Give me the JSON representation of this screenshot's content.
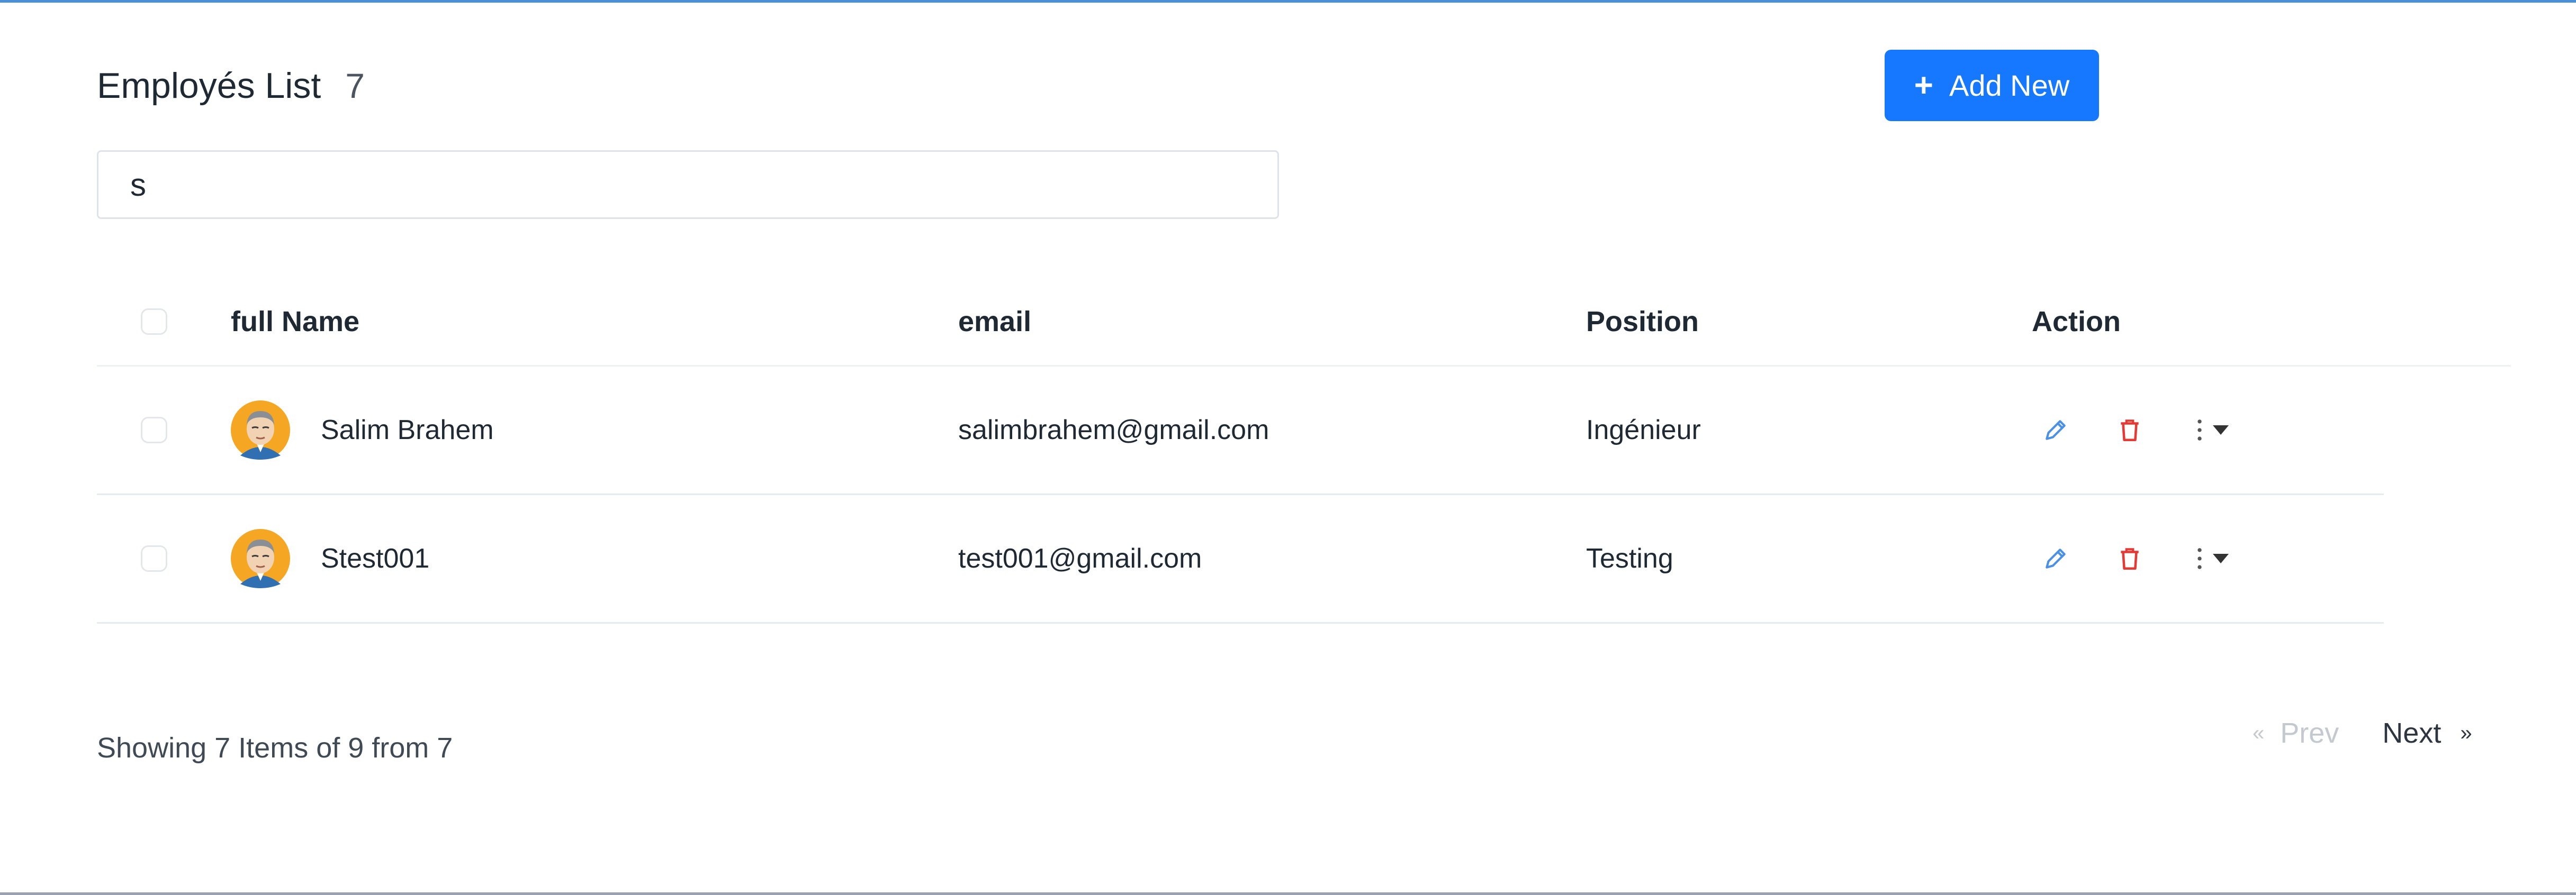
{
  "header": {
    "title": "Employés List",
    "count": "7",
    "add_button_label": "Add New"
  },
  "search": {
    "value": "s"
  },
  "table": {
    "columns": {
      "name": "full Name",
      "email": "email",
      "position": "Position",
      "action": "Action"
    },
    "rows": [
      {
        "name": "Salim Brahem",
        "email": "salimbrahem@gmail.com",
        "position": "Ingénieur",
        "avatar": "avatar-icon"
      },
      {
        "name": "Stest001",
        "email": "test001@gmail.com",
        "position": "Testing",
        "avatar": "avatar-icon"
      }
    ]
  },
  "footer": {
    "summary": "Showing 7 Items of 9 from 7",
    "prev_label": "Prev",
    "next_label": "Next",
    "prev_chevron": "«",
    "next_chevron": "»"
  },
  "colors": {
    "accent": "#1677ff",
    "edit_icon": "#4a8fe8",
    "delete_icon": "#e53935",
    "avatar_bg": "#f5a623"
  }
}
